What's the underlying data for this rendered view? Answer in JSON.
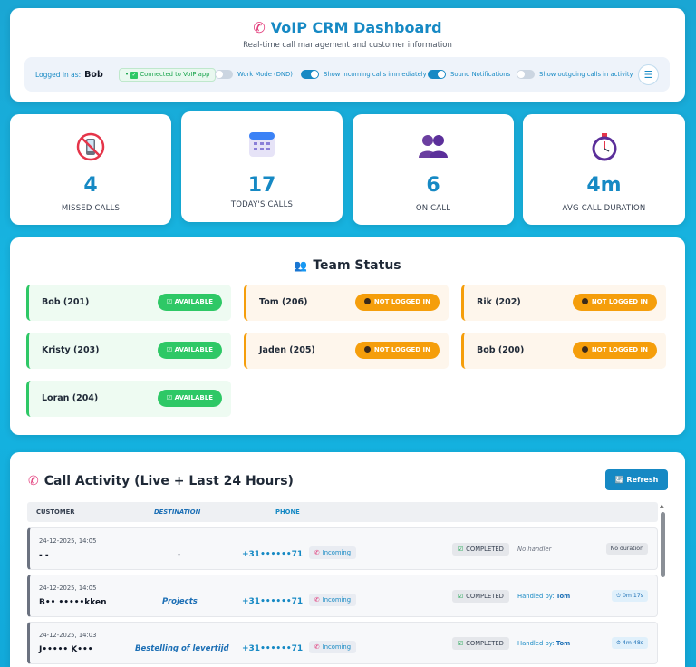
{
  "header": {
    "title": "VoIP CRM Dashboard",
    "subtitle": "Real-time call management and customer information",
    "logged_in_label": "Logged in as:",
    "user": "Bob",
    "connection": "Connected to VoIP app",
    "toggles": [
      {
        "label": "Work Mode (DND)",
        "on": false
      },
      {
        "label": "Show incoming calls immediately",
        "on": true
      },
      {
        "label": "Sound Notifications",
        "on": true
      },
      {
        "label": "Show outgoing calls in activity",
        "on": false
      }
    ],
    "menu_icon": "hamburger-menu-icon"
  },
  "stats": [
    {
      "icon": "no-phone-icon",
      "value": "4",
      "label": "MISSED CALLS"
    },
    {
      "icon": "calendar-icon",
      "value": "17",
      "label": "TODAY'S CALLS"
    },
    {
      "icon": "people-icon",
      "value": "6",
      "label": "ON CALL"
    },
    {
      "icon": "stopwatch-icon",
      "value": "4m",
      "label": "AVG CALL DURATION"
    }
  ],
  "team": {
    "title": "Team Status",
    "members": [
      {
        "name": "Bob (201)",
        "status": "AVAILABLE",
        "state": "available"
      },
      {
        "name": "Tom (206)",
        "status": "NOT LOGGED IN",
        "state": "offline"
      },
      {
        "name": "Rik (202)",
        "status": "NOT LOGGED IN",
        "state": "offline"
      },
      {
        "name": "Kristy (203)",
        "status": "AVAILABLE",
        "state": "available"
      },
      {
        "name": "Jaden (205)",
        "status": "NOT LOGGED IN",
        "state": "offline"
      },
      {
        "name": "Bob (200)",
        "status": "NOT LOGGED IN",
        "state": "offline"
      },
      {
        "name": "Loran (204)",
        "status": "AVAILABLE",
        "state": "available"
      }
    ]
  },
  "activity": {
    "title": "Call Activity (Live + Last 24 Hours)",
    "refresh_label": "Refresh",
    "columns": {
      "customer": "CUSTOMER",
      "destination": "DESTINATION",
      "phone": "PHONE"
    },
    "rows": [
      {
        "time": "24-12-2025, 14:05",
        "customer": "- -",
        "destination": "-",
        "phone": "+31••••••71",
        "direction": "Incoming",
        "status": "COMPLETED",
        "handler_label": "No handler",
        "handler": "",
        "duration": "No duration"
      },
      {
        "time": "24-12-2025, 14:05",
        "customer": "B•• •••••kken",
        "destination": "Projects",
        "phone": "+31••••••71",
        "direction": "Incoming",
        "status": "COMPLETED",
        "handler_label": "Handled by:",
        "handler": "Tom",
        "duration": "0m 17s"
      },
      {
        "time": "24-12-2025, 14:03",
        "customer": "J••••• K•••",
        "destination": "Bestelling of levertijd",
        "phone": "+31••••••71",
        "direction": "Incoming",
        "status": "COMPLETED",
        "handler_label": "Handled by:",
        "handler": "Tom",
        "duration": "4m 48s"
      }
    ]
  },
  "colors": {
    "accent": "#1689c4",
    "available": "#2ec866",
    "offline": "#f59e0b",
    "phone_icon": "#e23b7a"
  }
}
